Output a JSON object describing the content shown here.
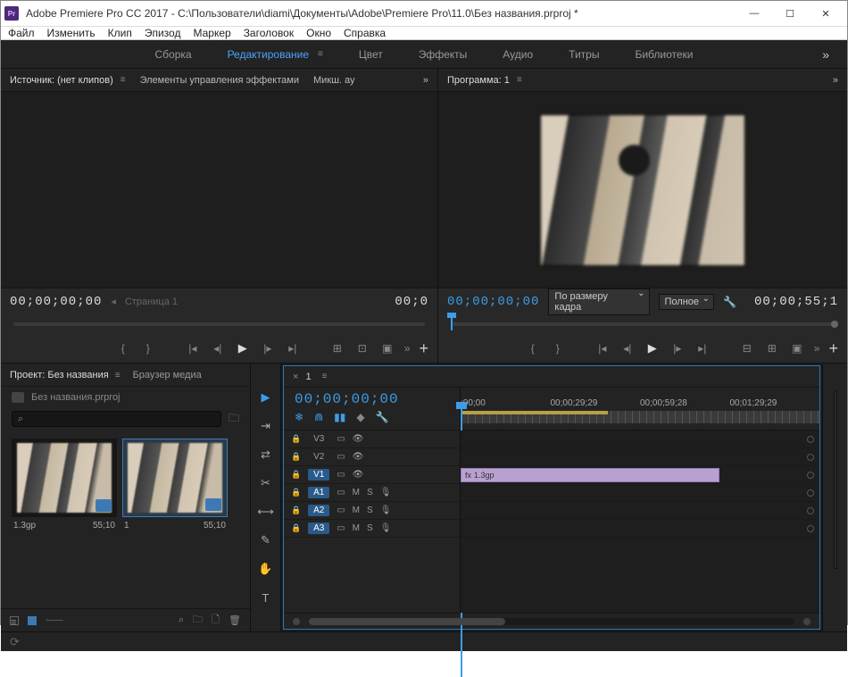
{
  "titlebar": {
    "app_icon_text": "Pr",
    "title": "Adobe Premiere Pro CC 2017 - C:\\Пользователи\\diami\\Документы\\Adobe\\Premiere Pro\\11.0\\Без названия.prproj *"
  },
  "menu": [
    "Файл",
    "Изменить",
    "Клип",
    "Эпизод",
    "Маркер",
    "Заголовок",
    "Окно",
    "Справка"
  ],
  "workspaces": {
    "items": [
      "Сборка",
      "Редактирование",
      "Цвет",
      "Эффекты",
      "Аудио",
      "Титры",
      "Библиотеки"
    ],
    "active": "Редактирование"
  },
  "source": {
    "tabs": [
      "Источник: (нет клипов)",
      "Элементы управления эффектами",
      "Микш. ау"
    ],
    "timecode_left": "00;00;00;00",
    "page": "Страница 1",
    "timecode_right": "00;0"
  },
  "program": {
    "tab": "Программа: 1",
    "timecode_left": "00;00;00;00",
    "fit": "По размеру кадра",
    "quality": "Полное",
    "timecode_right": "00;00;55;1"
  },
  "project": {
    "tabs": [
      "Проект: Без названия",
      "Браузер медиа"
    ],
    "file": "Без названия.prproj",
    "search_placeholder": "",
    "search_icon": "⌕",
    "clips": [
      {
        "name": "1.3gp",
        "dur": "55;10"
      },
      {
        "name": "1",
        "dur": "55;10"
      }
    ]
  },
  "timeline": {
    "seq_name": "1",
    "timecode": "00;00;00;00",
    "ruler": [
      ";00;00",
      "00;00;29;29",
      "00;00;59;28",
      "00;01;29;29"
    ],
    "tracks_video": [
      "V3",
      "V2",
      "V1"
    ],
    "tracks_audio": [
      "A1",
      "A2",
      "A3"
    ],
    "clip_name": "1.3gp"
  },
  "mute": "M",
  "solo": "S"
}
